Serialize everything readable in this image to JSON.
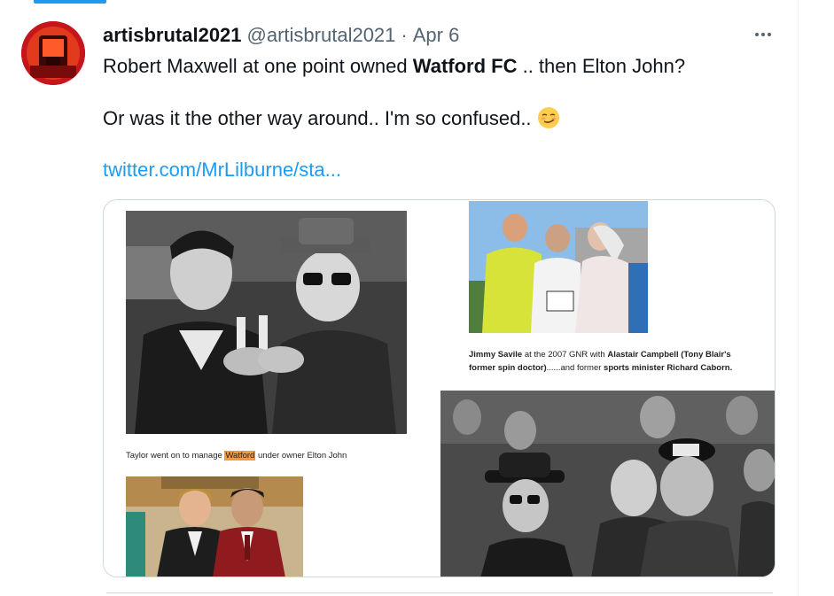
{
  "tweet": {
    "display_name": "artisbrutal2021",
    "handle": "@artisbrutal2021",
    "separator": "·",
    "date": "Apr 6",
    "text": {
      "line1_pre": "Robert Maxwell at one point owned ",
      "line1_bold": "Watford FC",
      "line1_post": " .. then Elton John?",
      "line2": "Or was it the other way around.. I'm so confused..",
      "line2_emoji": "smirking-face-emoji",
      "link": "twitter.com/MrLilburne/sta..."
    },
    "more_icon": "more-horizontal-icon",
    "avatar_icon": "red-avatar-icon"
  },
  "media": {
    "caption1_pre": "Taylor went on to manage ",
    "caption1_highlight": "Watford",
    "caption1_post": " under owner Elton John",
    "caption2_a": "Jimmy Savile",
    "caption2_b": " at the 2007 GNR with ",
    "caption2_c": "Alastair Campbell (Tony Blair's",
    "caption2_d": "former spin doctor)",
    "caption2_e": "......and former ",
    "caption2_f": "sports minister Richard Caborn."
  },
  "colors": {
    "accent": "#1d9bf0",
    "highlight": "#f59a3a",
    "text": "#0f1419",
    "muted": "#536471"
  }
}
